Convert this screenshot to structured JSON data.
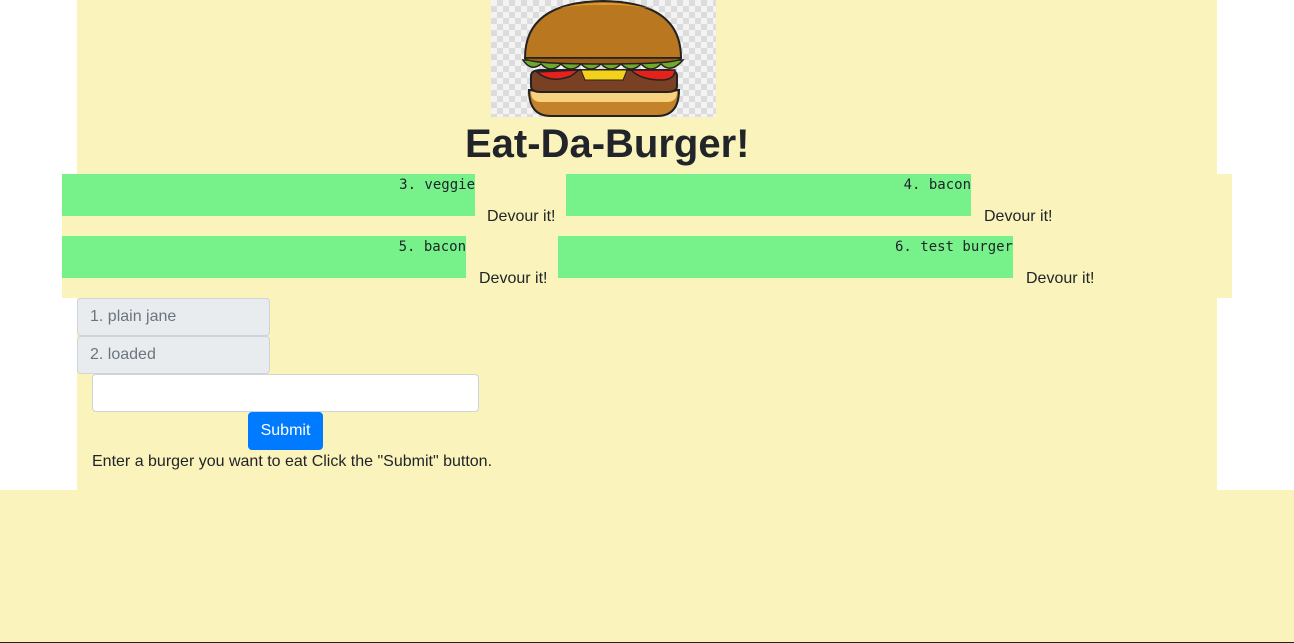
{
  "header": {
    "title": "Eat-Da-Burger!",
    "logo_icon": "burger-icon"
  },
  "uneaten_burgers": [
    {
      "label": "3. veggie",
      "devour_label": "Devour it!"
    },
    {
      "label": "4. bacon",
      "devour_label": "Devour it!"
    },
    {
      "label": "5. bacon",
      "devour_label": "Devour it!"
    },
    {
      "label": "6. test burger",
      "devour_label": "Devour it!"
    }
  ],
  "eaten_burgers": [
    {
      "label": "1. plain jane"
    },
    {
      "label": "2. loaded"
    }
  ],
  "form": {
    "input_value": "",
    "input_placeholder": "",
    "submit_label": "Submit",
    "instructions": "Enter a burger you want to eat Click the \"Submit\" button."
  },
  "colors": {
    "background": "#faf3bb",
    "burger_bar": "#77f28b",
    "submit_button": "#007bff"
  }
}
